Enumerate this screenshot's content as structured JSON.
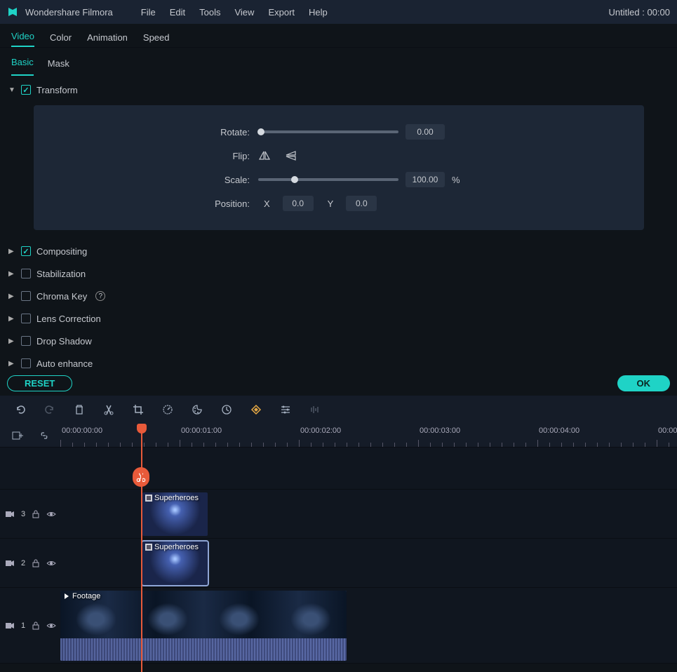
{
  "app_name": "Wondershare Filmora",
  "title_right": "Untitled : 00:00",
  "menu": [
    "File",
    "Edit",
    "Tools",
    "View",
    "Export",
    "Help"
  ],
  "prop_tabs": [
    "Video",
    "Color",
    "Animation",
    "Speed"
  ],
  "sub_tabs": [
    "Basic",
    "Mask"
  ],
  "transform": {
    "label": "Transform",
    "rotate_label": "Rotate:",
    "rotate_val": "0.00",
    "flip_label": "Flip:",
    "scale_label": "Scale:",
    "scale_val": "100.00",
    "scale_unit": "%",
    "position_label": "Position:",
    "x_label": "X",
    "x_val": "0.0",
    "y_label": "Y",
    "y_val": "0.0"
  },
  "sections": [
    {
      "label": "Compositing",
      "checked": true
    },
    {
      "label": "Stabilization",
      "checked": false
    },
    {
      "label": "Chroma Key",
      "checked": false,
      "help": true
    },
    {
      "label": "Lens Correction",
      "checked": false
    },
    {
      "label": "Drop Shadow",
      "checked": false
    },
    {
      "label": "Auto enhance",
      "checked": false
    }
  ],
  "buttons": {
    "reset": "RESET",
    "ok": "OK"
  },
  "ruler": [
    "00:00:00:00",
    "00:00:01:00",
    "00:00:02:00",
    "00:00:03:00",
    "00:00:04:00",
    "00:00"
  ],
  "tracks": {
    "t3": "3",
    "t2": "2",
    "t1": "1"
  },
  "clips": {
    "super1": "Superheroes",
    "super2": "Superheroes",
    "footage": "Footage"
  }
}
